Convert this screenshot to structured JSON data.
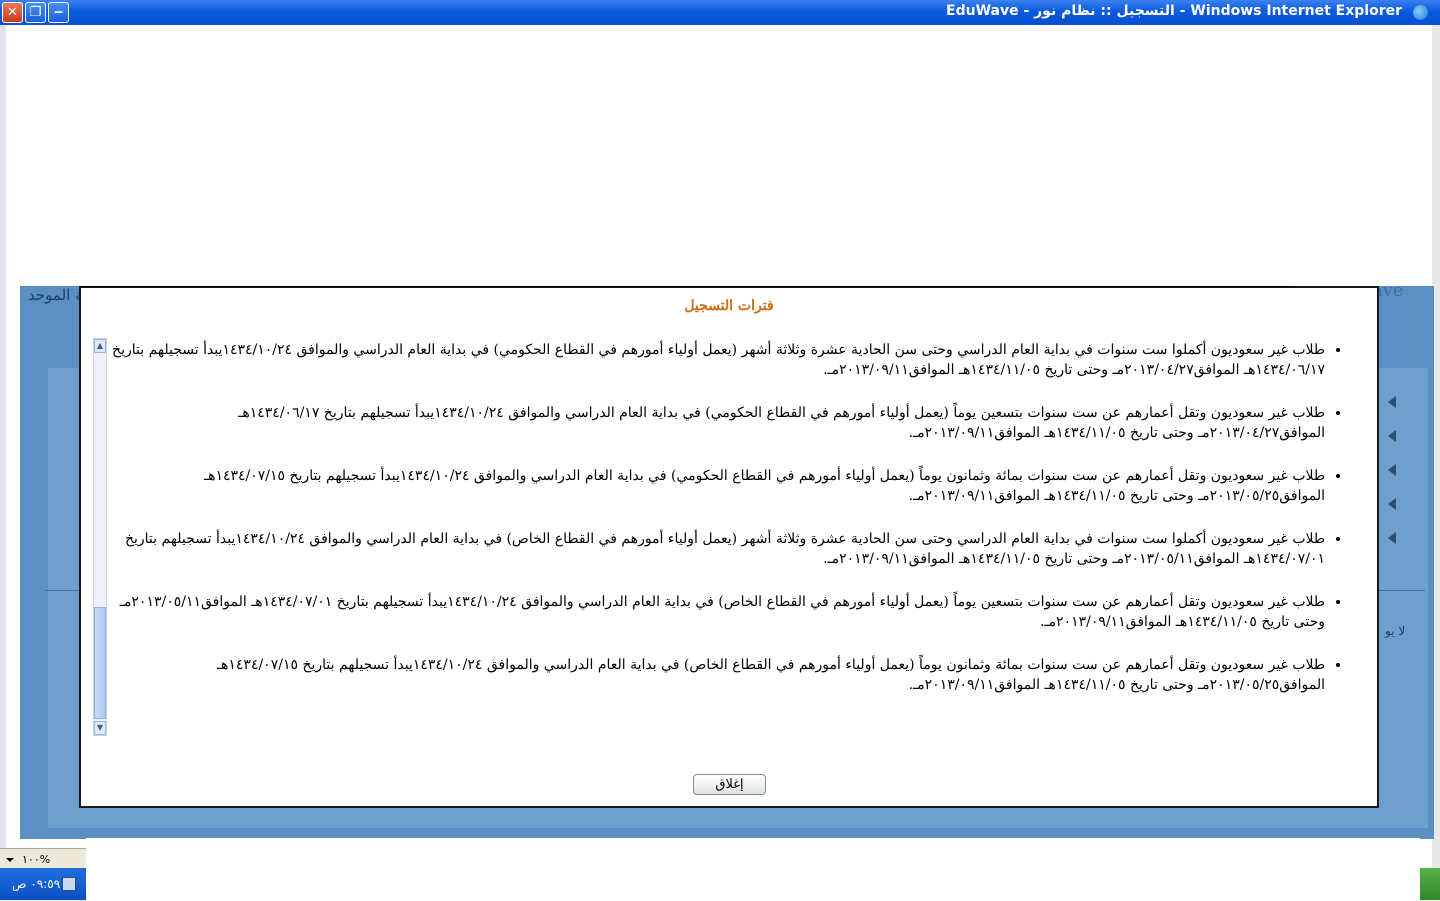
{
  "window": {
    "title": "EduWave - التسجيل :: نظام نور - Windows Internet Explorer",
    "buttons": {
      "close": "✕",
      "restore": "❐",
      "minimize": "‒"
    }
  },
  "background": {
    "fragment_left": "ية الموحد",
    "fragment_right": "ave",
    "fragment_bottom": "لا يو"
  },
  "dialog": {
    "title": "فترات التسجيل",
    "items": [
      "طلاب غير سعوديون أكملوا ست سنوات في بداية العام الدراسي وحتى سن الحادية عشرة وثلاثة أشهر (يعمل أولياء أمورهم في القطاع الحكومي) في بداية العام الدراسي والموافق ١٤٣٤/١٠/٢٤يبدأ تسجيلهم بتاريخ ١٤٣٤/٠٦/١٧هـ الموافق٢٠١٣/٠٤/٢٧مـ وحتى تاريخ ١٤٣٤/١١/٠٥هـ الموافق٢٠١٣/٠٩/١١مـ.",
      "طلاب غير سعوديون وتقل أعمارهم عن ست سنوات بتسعين يوماً (يعمل أولياء أمورهم في القطاع الحكومي) في بداية العام الدراسي والموافق ١٤٣٤/١٠/٢٤يبدأ تسجيلهم بتاريخ ١٤٣٤/٠٦/١٧هـ الموافق٢٠١٣/٠٤/٢٧مـ وحتى تاريخ ١٤٣٤/١١/٠٥هـ الموافق٢٠١٣/٠٩/١١مـ.",
      "طلاب غير سعوديون وتقل أعمارهم عن ست سنوات بمائة وثمانون يوماً (يعمل أولياء أمورهم في القطاع الحكومي) في بداية العام الدراسي والموافق ١٤٣٤/١٠/٢٤يبدأ تسجيلهم بتاريخ ١٤٣٤/٠٧/١٥هـ الموافق٢٠١٣/٠٥/٢٥مـ وحتى تاريخ ١٤٣٤/١١/٠٥هـ الموافق٢٠١٣/٠٩/١١مـ.",
      "طلاب غير سعوديون أكملوا ست سنوات في بداية العام الدراسي وحتى سن الحادية عشرة وثلاثة أشهر (يعمل أولياء أمورهم في القطاع الخاص) في بداية العام الدراسي والموافق ١٤٣٤/١٠/٢٤يبدأ تسجيلهم بتاريخ ١٤٣٤/٠٧/٠١هـ الموافق٢٠١٣/٠٥/١١مـ وحتى تاريخ ١٤٣٤/١١/٠٥هـ الموافق٢٠١٣/٠٩/١١مـ.",
      "طلاب غير سعوديون وتقل أعمارهم عن ست سنوات بتسعين يوماً (يعمل أولياء أمورهم في القطاع الخاص) في بداية العام الدراسي والموافق ١٤٣٤/١٠/٢٤يبدأ تسجيلهم بتاريخ ١٤٣٤/٠٧/٠١هـ الموافق٢٠١٣/٠٥/١١مـ وحتى تاريخ ١٤٣٤/١١/٠٥هـ الموافق٢٠١٣/٠٩/١١مـ.",
      "طلاب غير سعوديون وتقل أعمارهم عن ست سنوات بمائة وثمانون يوماً (يعمل أولياء أمورهم في القطاع الخاص) في بداية العام الدراسي والموافق ١٤٣٤/١٠/٢٤يبدأ تسجيلهم بتاريخ ١٤٣٤/٠٧/١٥هـ الموافق٢٠١٣/٠٥/٢٥مـ وحتى تاريخ ١٤٣٤/١١/٠٥هـ الموافق٢٠١٣/٠٩/١١مـ."
    ],
    "close_label": "إغلاق"
  },
  "statusbar": {
    "zoom": "١٠٠%"
  },
  "taskbar": {
    "clock": "٠٩:٥٩ ص"
  },
  "colors": {
    "title_accent": "#d46a14",
    "titlebar": "#0b5ae0",
    "page_bg": "#5b8fc3"
  }
}
